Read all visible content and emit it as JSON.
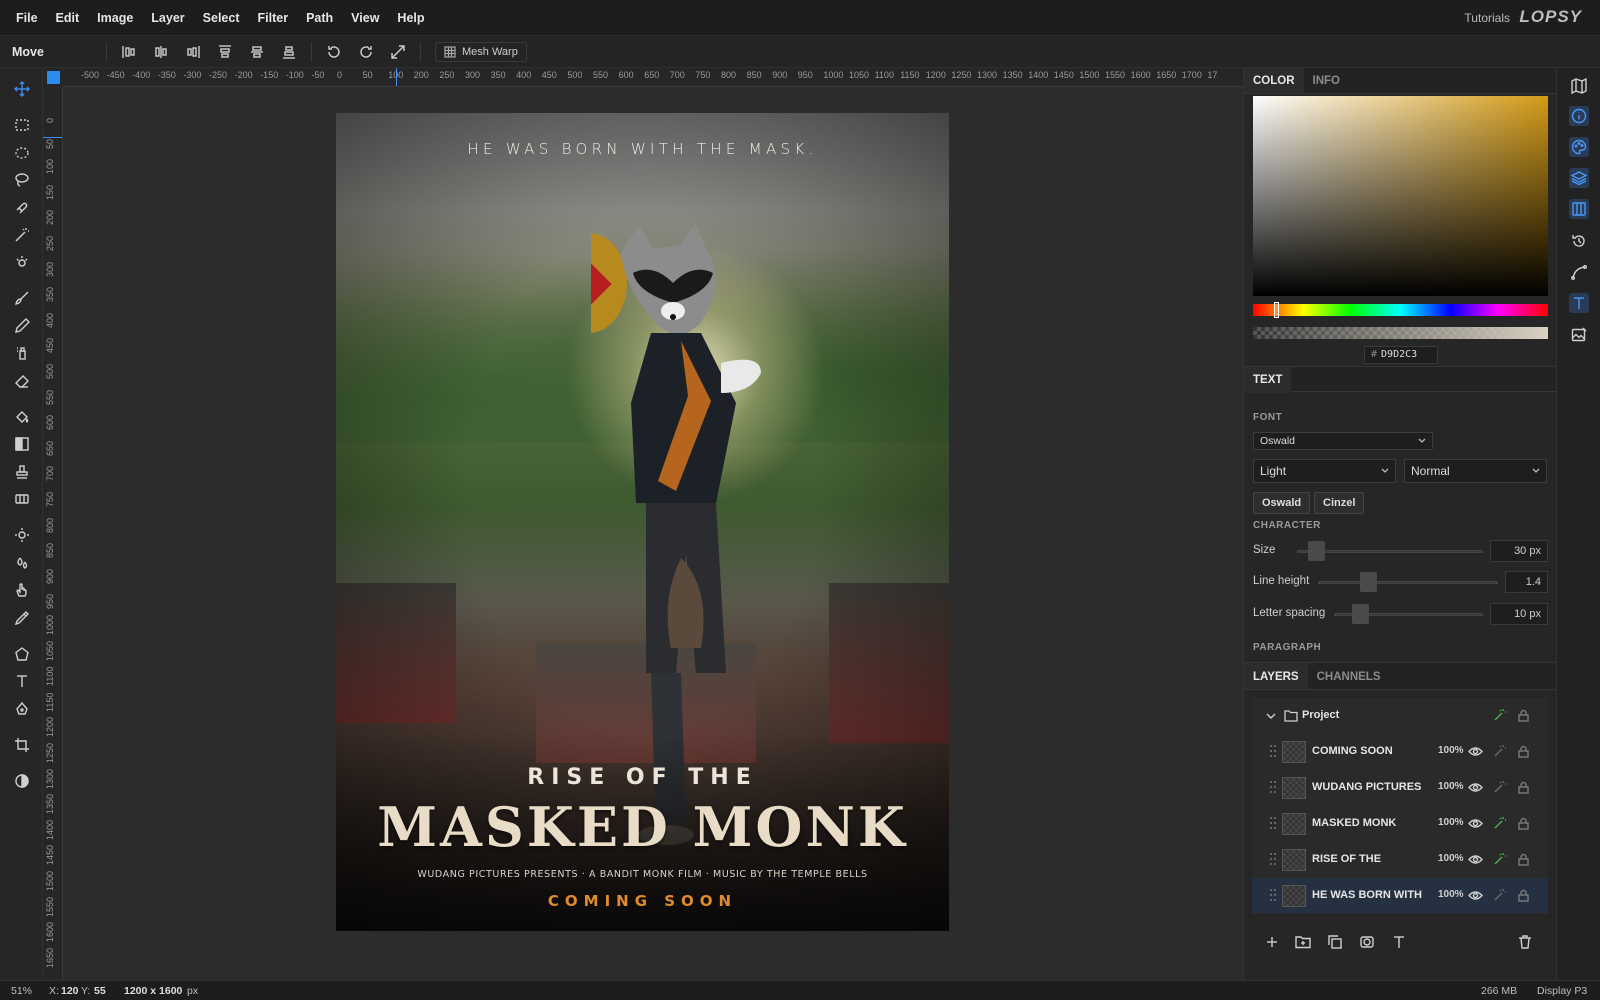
{
  "menubar": {
    "items": [
      "File",
      "Edit",
      "Image",
      "Layer",
      "Select",
      "Filter",
      "Path",
      "View",
      "Help"
    ],
    "tutorials": "Tutorials",
    "logo": "LOPSY"
  },
  "options": {
    "tool_name": "Move",
    "mesh_warp": "Mesh Warp"
  },
  "rulers": {
    "horizontal": [
      "-500",
      "-450",
      "-400",
      "-350",
      "-300",
      "-250",
      "-200",
      "-150",
      "-100",
      "-50",
      "0",
      "50",
      "100",
      "200",
      "250",
      "300",
      "350",
      "400",
      "450",
      "500",
      "550",
      "600",
      "650",
      "700",
      "750",
      "800",
      "850",
      "900",
      "950",
      "1000",
      "1050",
      "1100",
      "1150",
      "1200",
      "1250",
      "1300",
      "1350",
      "1400",
      "1450",
      "1500",
      "1550",
      "1600",
      "1650",
      "1700",
      "17"
    ],
    "vertical": [
      "0",
      "50",
      "100",
      "150",
      "200",
      "250",
      "300",
      "350",
      "400",
      "450",
      "500",
      "550",
      "600",
      "650",
      "700",
      "750",
      "800",
      "850",
      "900",
      "950",
      "1000",
      "1050",
      "1100",
      "1150",
      "1200",
      "1250",
      "1300",
      "1350",
      "1400",
      "1450",
      "1500",
      "1550",
      "1600",
      "1650"
    ]
  },
  "poster": {
    "tagline": "HE WAS BORN WITH THE MASK.",
    "rise": "RISE OF THE",
    "title": "MASKED MONK",
    "credits": "WUDANG PICTURES PRESENTS · A BANDIT MONK FILM · MUSIC BY THE TEMPLE BELLS",
    "coming": "COMING SOON"
  },
  "color_panel": {
    "tabs": [
      "COLOR",
      "INFO"
    ],
    "hex_prefix": "#",
    "hex": "D9D2C3"
  },
  "text_panel": {
    "tab": "TEXT",
    "font_label": "FONT",
    "font_family": "Oswald",
    "weight": "Light",
    "style": "Normal",
    "quick_fonts": [
      "Oswald",
      "Cinzel"
    ],
    "character_label": "CHARACTER",
    "size_label": "Size",
    "size_value": "30",
    "size_unit": "px",
    "line_height_label": "Line height",
    "line_height_value": "1.4",
    "letter_spacing_label": "Letter spacing",
    "letter_spacing_value": "10",
    "letter_spacing_unit": "px",
    "paragraph_label": "PARAGRAPH"
  },
  "layers_panel": {
    "tabs": [
      "LAYERS",
      "CHANNELS"
    ],
    "group": "Project",
    "layers": [
      {
        "name": "COMING SOON",
        "opacity": "100%",
        "fx": false
      },
      {
        "name": "WUDANG PICTURES",
        "opacity": "100%",
        "fx": false
      },
      {
        "name": "MASKED MONK",
        "opacity": "100%",
        "fx": true
      },
      {
        "name": "RISE OF THE",
        "opacity": "100%",
        "fx": true
      },
      {
        "name": "HE WAS BORN WITH",
        "opacity": "100%",
        "fx": false
      }
    ]
  },
  "status": {
    "zoom": "51%",
    "x_label": "X:",
    "x": "120",
    "y_label": "Y:",
    "y": "55",
    "doc_size": "1200 x 1600",
    "doc_unit": "px",
    "memory": "266 MB",
    "profile": "Display P3"
  },
  "colors": {
    "accent": "#2b8cf0",
    "fx_green": "#4caf50",
    "coming_orange": "#e28b2c",
    "selected_color": "#D9D2C3"
  }
}
